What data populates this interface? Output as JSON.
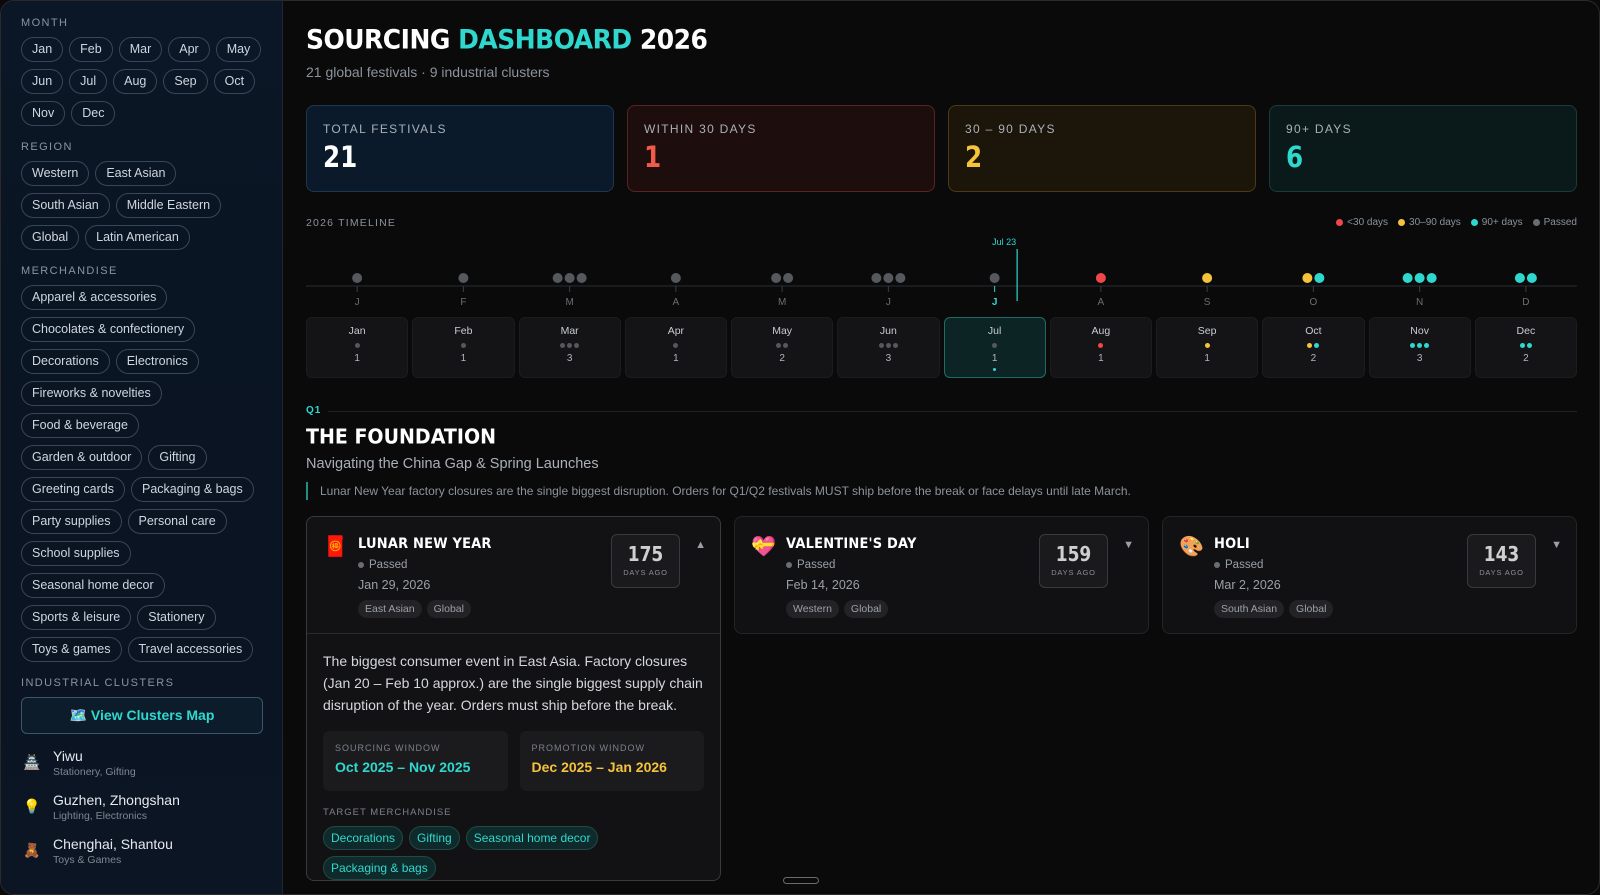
{
  "sidebar": {
    "month_heading": "MONTH",
    "months": [
      "Jan",
      "Feb",
      "Mar",
      "Apr",
      "May",
      "Jun",
      "Jul",
      "Aug",
      "Sep",
      "Oct",
      "Nov",
      "Dec"
    ],
    "region_heading": "REGION",
    "regions": [
      "Western",
      "East Asian",
      "South Asian",
      "Middle Eastern",
      "Global",
      "Latin American"
    ],
    "merch_heading": "MERCHANDISE",
    "merchandise": [
      "Apparel & accessories",
      "Chocolates & confectionery",
      "Decorations",
      "Electronics",
      "Fireworks & novelties",
      "Food & beverage",
      "Garden & outdoor",
      "Gifting",
      "Greeting cards",
      "Packaging & bags",
      "Party supplies",
      "Personal care",
      "School supplies",
      "Seasonal home decor",
      "Sports & leisure",
      "Stationery",
      "Toys & games",
      "Travel accessories"
    ],
    "clusters_heading": "INDUSTRIAL CLUSTERS",
    "clusters_button": "🗺️ View Clusters Map",
    "clusters": [
      {
        "icon": "🏯",
        "name": "Yiwu",
        "sub": "Stationery, Gifting"
      },
      {
        "icon": "💡",
        "name": "Guzhen, Zhongshan",
        "sub": "Lighting, Electronics"
      },
      {
        "icon": "🧸",
        "name": "Chenghai, Shantou",
        "sub": "Toys & Games"
      }
    ]
  },
  "header": {
    "title_part1": "SOURCING ",
    "title_accent": "DASHBOARD",
    "title_part2": " 2026",
    "subtitle": "21 global festivals · 9 industrial clusters"
  },
  "stats": [
    {
      "label": "TOTAL FESTIVALS",
      "value": "21"
    },
    {
      "label": "WITHIN 30 DAYS",
      "value": "1"
    },
    {
      "label": "30 – 90 DAYS",
      "value": "2"
    },
    {
      "label": "90+ DAYS",
      "value": "6"
    }
  ],
  "timeline": {
    "title": "2026 TIMELINE",
    "today_label": "Jul 23",
    "today_position": 6.72,
    "legend": [
      {
        "label": "<30 days",
        "color": "#f04848"
      },
      {
        "label": "30–90 days",
        "color": "#f5c33b"
      },
      {
        "label": "90+ days",
        "color": "#2fd8cf"
      },
      {
        "label": "Passed",
        "color": "#6a6d72"
      }
    ],
    "months": [
      {
        "letter": "J",
        "name": "Jan",
        "count": "1",
        "dots": [
          "passed"
        ]
      },
      {
        "letter": "F",
        "name": "Feb",
        "count": "1",
        "dots": [
          "passed"
        ]
      },
      {
        "letter": "M",
        "name": "Mar",
        "count": "3",
        "dots": [
          "passed",
          "passed",
          "passed"
        ]
      },
      {
        "letter": "A",
        "name": "Apr",
        "count": "1",
        "dots": [
          "passed"
        ]
      },
      {
        "letter": "M",
        "name": "May",
        "count": "2",
        "dots": [
          "passed",
          "passed"
        ]
      },
      {
        "letter": "J",
        "name": "Jun",
        "count": "3",
        "dots": [
          "passed",
          "passed",
          "passed"
        ]
      },
      {
        "letter": "J",
        "name": "Jul",
        "count": "1",
        "dots": [
          "passed"
        ],
        "active": true
      },
      {
        "letter": "A",
        "name": "Aug",
        "count": "1",
        "dots": [
          "lt30"
        ]
      },
      {
        "letter": "S",
        "name": "Sep",
        "count": "1",
        "dots": [
          "mid"
        ]
      },
      {
        "letter": "O",
        "name": "Oct",
        "count": "2",
        "dots": [
          "mid",
          "far"
        ]
      },
      {
        "letter": "N",
        "name": "Nov",
        "count": "3",
        "dots": [
          "far",
          "far",
          "far"
        ]
      },
      {
        "letter": "D",
        "name": "Dec",
        "count": "2",
        "dots": [
          "far",
          "far"
        ]
      }
    ]
  },
  "colors": {
    "passed": "#55585d",
    "lt30": "#f04848",
    "mid": "#f5c33b",
    "far": "#2fd8cf",
    "accent": "#2fd8cf"
  },
  "section": {
    "quarter": "Q1",
    "title": "THE FOUNDATION",
    "subtitle": "Navigating the China Gap & Spring Launches",
    "note": "Lunar New Year factory closures are the single biggest disruption. Orders for Q1/Q2 festivals MUST ship before the break or face delays until late March."
  },
  "festivals": [
    {
      "icon": "🧧",
      "name": "LUNAR NEW YEAR",
      "status": "Passed",
      "date": "Jan 29, 2026",
      "tags": [
        "East Asian",
        "Global"
      ],
      "days": "175",
      "days_label": "DAYS AGO",
      "chevron": "▲",
      "description": "The biggest consumer event in East Asia. Factory closures (Jan 20 – Feb 10 approx.) are the single biggest supply chain disruption of the year. Orders must ship before the break.",
      "sourcing_label": "SOURCING WINDOW",
      "sourcing_value": "Oct 2025 – Nov 2025",
      "promotion_label": "PROMOTION WINDOW",
      "promotion_value": "Dec 2025 – Jan 2026",
      "target_label": "TARGET MERCHANDISE",
      "target": [
        "Decorations",
        "Gifting",
        "Seasonal home decor",
        "Packaging & bags"
      ]
    },
    {
      "icon": "💝",
      "name": "VALENTINE'S DAY",
      "status": "Passed",
      "date": "Feb 14, 2026",
      "tags": [
        "Western",
        "Global"
      ],
      "days": "159",
      "days_label": "DAYS AGO",
      "chevron": "▼"
    },
    {
      "icon": "🎨",
      "name": "HOLI",
      "status": "Passed",
      "date": "Mar 2, 2026",
      "tags": [
        "South Asian",
        "Global"
      ],
      "days": "143",
      "days_label": "DAYS AGO",
      "chevron": "▼"
    }
  ]
}
